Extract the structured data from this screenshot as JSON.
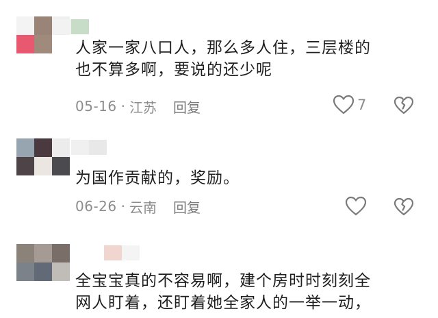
{
  "comments": [
    {
      "lines": [
        "人家一家八口人，那么多人住，三层楼的",
        "也不算多啊，要说的还少呢"
      ],
      "date": "05-16",
      "separator": "·",
      "location": "江苏",
      "reply_label": "回复",
      "like_count": "7",
      "avatar_colors": [
        "#f3f3f3",
        "#9a8478",
        "#eef0f0",
        "#e8586e",
        "#a08a7c",
        "#ffffff"
      ],
      "name_colors": [
        "#f2f2f2",
        "#c7ddc8"
      ]
    },
    {
      "lines": [
        "为国作贡献的，奖励。"
      ],
      "date": "06-26",
      "separator": "·",
      "location": "云南",
      "reply_label": "回复",
      "like_count": "",
      "avatar_colors": [
        "#97a5b0",
        "#4a3a3f",
        "#ececec",
        "#4e4448",
        "#ece6e2",
        "#4b4a4e"
      ],
      "name_colors": [
        "#f0f0f0",
        "#e8e8e8"
      ]
    },
    {
      "lines": [
        "全宝宝真的不容易啊，建个房时时刻刻全",
        "网人盯着，还盯着她全家人的一举一动，"
      ],
      "date": "",
      "separator": "",
      "location": "",
      "reply_label": "",
      "like_count": "",
      "avatar_colors": [
        "#8b8279",
        "#a59a94",
        "#7a6e68",
        "#7c828a",
        "#626a78",
        "#c0bcb8"
      ],
      "name_colors": [
        "#f1d6cf",
        "#f4f4f4"
      ]
    }
  ],
  "icons": {
    "like": "heart-outline-icon",
    "dislike": "broken-heart-icon"
  }
}
